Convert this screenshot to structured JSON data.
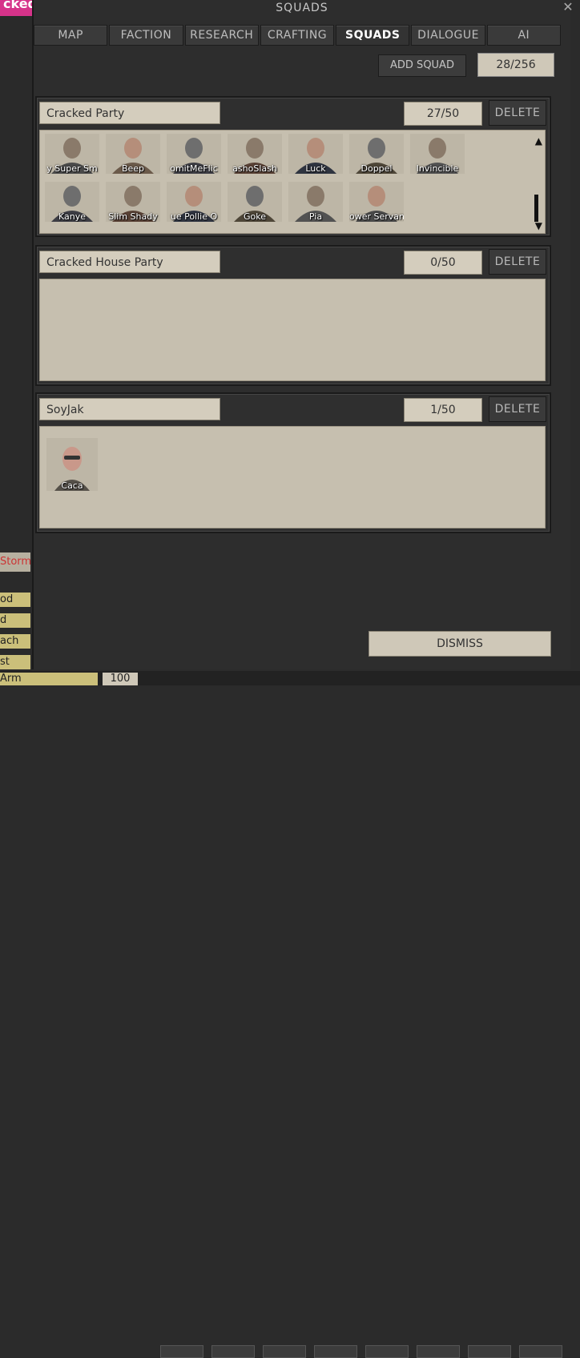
{
  "overlay": {
    "text": "ckedparty"
  },
  "window": {
    "title": "SQUADS",
    "close_label": "✕"
  },
  "tabs": [
    {
      "label": "MAP",
      "active": false
    },
    {
      "label": "FACTION",
      "active": false
    },
    {
      "label": "RESEARCH",
      "active": false
    },
    {
      "label": "CRAFTING",
      "active": false
    },
    {
      "label": "SQUADS",
      "active": true
    },
    {
      "label": "DIALOGUE",
      "active": false
    },
    {
      "label": "AI",
      "active": false
    }
  ],
  "toolbar": {
    "add_squad_label": "ADD SQUAD",
    "total": "28/256"
  },
  "squads": [
    {
      "name": "Cracked Party",
      "count": "27/50",
      "delete_label": "DELETE",
      "members_row1": [
        "y Super Sm",
        "Beep",
        "omitMeFlic",
        "ashoSlash",
        "Luck",
        "Doppel",
        "Invincible"
      ],
      "members_row2": [
        "Kanye",
        "Slim Shady",
        "ue Pollie O",
        "Goke",
        "Pia",
        "ower Servan"
      ]
    },
    {
      "name": "Cracked House Party",
      "count": "0/50",
      "delete_label": "DELETE",
      "members": []
    },
    {
      "name": "SoyJak",
      "count": "1/50",
      "delete_label": "DELETE",
      "members": [
        "Caca"
      ]
    }
  ],
  "dismiss_label": "DISMISS",
  "left_panel": {
    "storm": "Storm",
    "labels": [
      "od",
      "d",
      "ach",
      "st"
    ]
  },
  "bottom": {
    "arm_label": "Arm",
    "value": "100"
  }
}
